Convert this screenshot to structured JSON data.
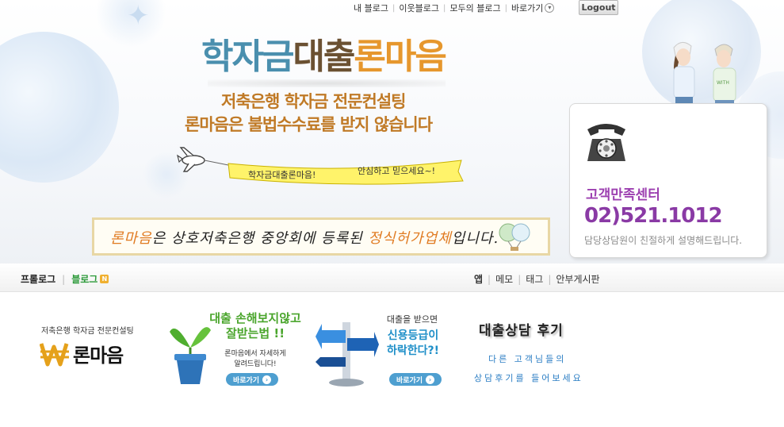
{
  "top_nav": {
    "links": [
      "내 블로그",
      "이웃블로그",
      "모두의 블로그",
      "바로가기"
    ],
    "logout_label": "Logout"
  },
  "header": {
    "headline_part1": "학자금",
    "headline_part2": "대출",
    "headline_part3": "론마음",
    "subtitle1": "저축은행 학자금 전문컨설팅",
    "subtitle2": "론마음은 불법수수료를 받지 않습니다",
    "banner_left": "학자금대출론마음!",
    "banner_right": "안심하고 믿으세요~!",
    "notice_highlight1": "론마음",
    "notice_mid": "은 상호저축은행 중앙회에 등록된 ",
    "notice_highlight2": "정식허가업체",
    "notice_end": "입니다."
  },
  "customer_center": {
    "title": "고객만족센터",
    "phone": "02)521.1012",
    "desc": "담당상담원이 친절하게 설명해드립니다."
  },
  "menu": {
    "profile": "프롤로그",
    "blog": "블로그",
    "blog_badge": "N",
    "right": [
      "앱",
      "메모",
      "태그",
      "안부게시판"
    ]
  },
  "promos": {
    "logo_sub": "저축은행 학자금 전문컨설팅",
    "logo_text": "론마음",
    "promo1_title_line1": "대출 손해보지않고",
    "promo1_title_line2": "잘받는법 !!",
    "promo1_desc_line1": "론마음에서 자세하게",
    "promo1_desc_line2": "알려드립니다!",
    "promo2_small": "대출을 받으면",
    "promo2_title_line1": "신용등급이",
    "promo2_title_line2": "하락한다?!",
    "go_label": "바로가기",
    "review_title": "대출상담 후기",
    "review_line1": "다른 고객님들의",
    "review_line2": "상담후기를 들어보세요"
  },
  "colors": {
    "headline_blue": "#4a8fae",
    "headline_brown": "#6b5132",
    "headline_orange": "#e6972d",
    "accent_purple": "#8a3aa5",
    "blog_green": "#2d9a3a",
    "promo_green": "#4aa52c",
    "promo_blue": "#1f8fc8"
  }
}
